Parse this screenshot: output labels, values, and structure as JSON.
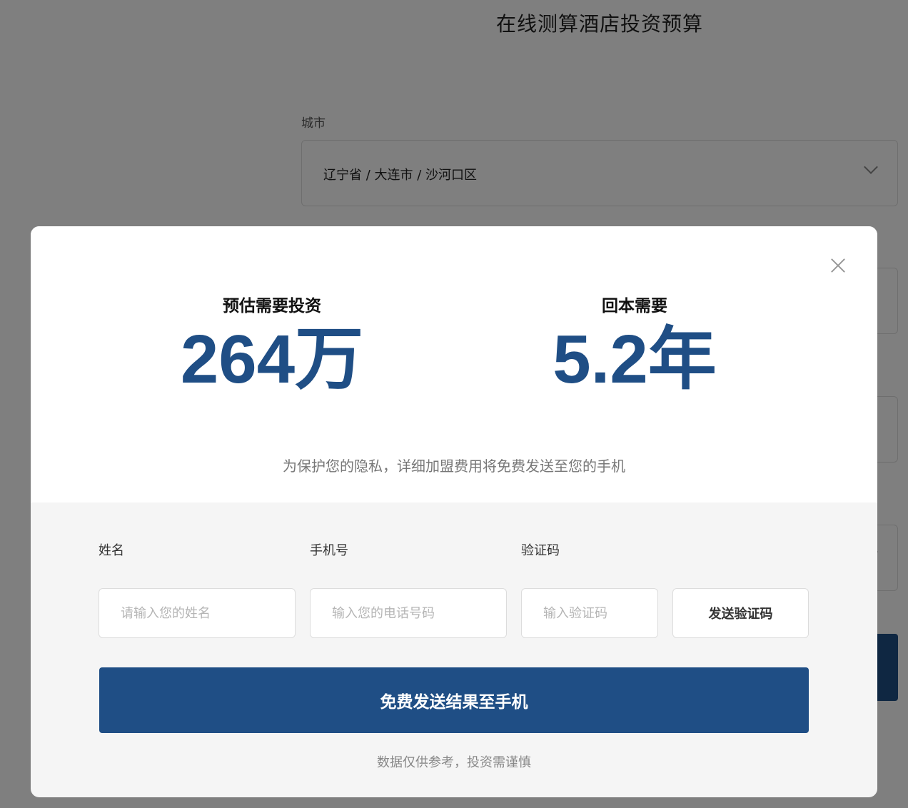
{
  "background": {
    "title": "在线测算酒店投资预算",
    "city_label": "城市",
    "city_value": "辽宁省 / 大连市 / 沙河口区"
  },
  "modal": {
    "investment_label": "预估需要投资",
    "investment_value": "264万",
    "payback_label": "回本需要",
    "payback_value": "5.2年",
    "privacy_note": "为保护您的隐私，详细加盟费用将免费发送至您的手机",
    "name_label": "姓名",
    "name_placeholder": "请输入您的姓名",
    "phone_label": "手机号",
    "phone_placeholder": "输入您的电话号码",
    "code_label": "验证码",
    "code_placeholder": "输入验证码",
    "send_code_label": "发送验证码",
    "submit_label": "免费发送结果至手机",
    "disclaimer": "数据仅供参考，投资需谨慎"
  },
  "icons": {
    "close": "close-icon",
    "chevron": "chevron-down-icon"
  },
  "colors": {
    "primary": "#1f4e85",
    "overlay": "rgba(0,0,0,0.5)"
  }
}
